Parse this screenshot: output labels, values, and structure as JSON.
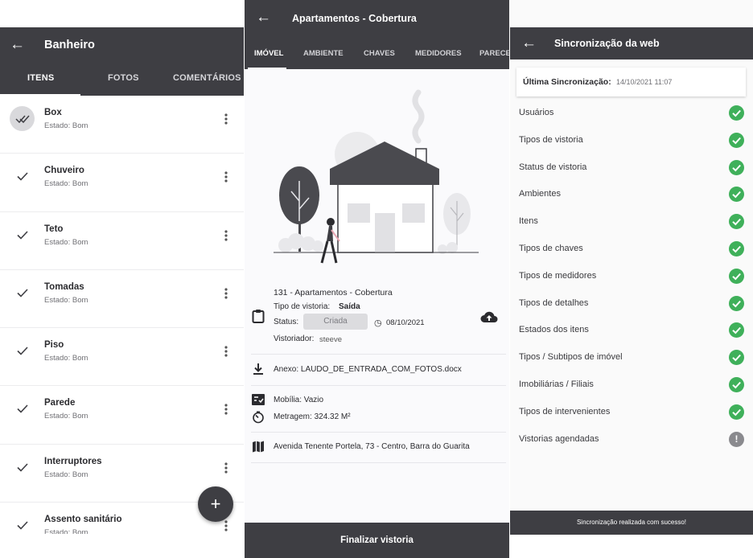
{
  "screen1": {
    "title": "Banheiro",
    "tabs": [
      {
        "label": "ITENS",
        "active": true
      },
      {
        "label": "FOTOS",
        "active": false
      },
      {
        "label": "COMENTÁRIOS",
        "active": false
      }
    ],
    "items": [
      {
        "name": "Box",
        "state": "Estado: Bom",
        "selected": true
      },
      {
        "name": "Chuveiro",
        "state": "Estado: Bom",
        "selected": false
      },
      {
        "name": "Teto",
        "state": "Estado: Bom",
        "selected": false
      },
      {
        "name": "Tomadas",
        "state": "Estado: Bom",
        "selected": false
      },
      {
        "name": "Piso",
        "state": "Estado: Bom",
        "selected": false
      },
      {
        "name": "Parede",
        "state": "Estado: Bom",
        "selected": false
      },
      {
        "name": "Interruptores",
        "state": "Estado: Bom",
        "selected": false
      },
      {
        "name": "Assento sanitário",
        "state": "Estado: Bom",
        "selected": false
      }
    ],
    "fab_label": "+",
    "icons": {
      "back": "arrow-left-icon",
      "check": "check-icon",
      "double_check": "double-check-icon",
      "more": "more-vert-icon",
      "add": "plus-icon"
    }
  },
  "screen2": {
    "title": "Apartamentos - Cobertura",
    "tabs": [
      "IMÓVEL",
      "AMBIENTE",
      "CHAVES",
      "MEDIDORES",
      "PARECER"
    ],
    "active_tab": "IMÓVEL",
    "property": {
      "heading": "131 - Apartamentos - Cobertura",
      "tipo_label": "Tipo de vistoria:",
      "tipo_value": "Saída",
      "status_label": "Status:",
      "status_value": "Criada",
      "date": "08/10/2021",
      "vistoriador_label": "Vistoriador:",
      "vistoriador_value": "steeve"
    },
    "anexo": "Anexo: LAUDO_DE_ENTRADA_COM_FOTOS.docx",
    "mobilia": "Mobília: Vazio",
    "metragem": "Metragem: 324.32 M²",
    "endereco": "Avenida Tenente Portela, 73 - Centro, Barra do Guarita",
    "finalize_label": "Finalizar vistoria",
    "icons": {
      "clipboard": "clipboard-icon",
      "clock": "clock-icon",
      "upload": "cloud-upload-icon",
      "download": "download-icon",
      "checklist": "checklist-icon",
      "timer": "timer-icon",
      "map": "map-icon"
    }
  },
  "screen3": {
    "title": "Sincronização da web",
    "last_sync_label": "Última Sincronização:",
    "last_sync_value": "14/10/2021 11:07",
    "items": [
      {
        "label": "Usuários",
        "status": "ok"
      },
      {
        "label": "Tipos de vistoria",
        "status": "ok"
      },
      {
        "label": "Status de vistoria",
        "status": "ok"
      },
      {
        "label": "Ambientes",
        "status": "ok"
      },
      {
        "label": "Itens",
        "status": "ok"
      },
      {
        "label": "Tipos de chaves",
        "status": "ok"
      },
      {
        "label": "Tipos de medidores",
        "status": "ok"
      },
      {
        "label": "Tipos de detalhes",
        "status": "ok"
      },
      {
        "label": "Estados dos itens",
        "status": "ok"
      },
      {
        "label": "Tipos / Subtipos de imóvel",
        "status": "ok"
      },
      {
        "label": "Imobiliárias / Filiais",
        "status": "ok"
      },
      {
        "label": "Tipos de intervenientes",
        "status": "ok"
      },
      {
        "label": "Vistorias agendadas",
        "status": "warn"
      }
    ],
    "snackbar": "Sincronização realizada com sucesso!",
    "colors": {
      "ok": "#3fb05a",
      "warn": "#8a8a8e",
      "appbar": "#3e3e43"
    }
  }
}
